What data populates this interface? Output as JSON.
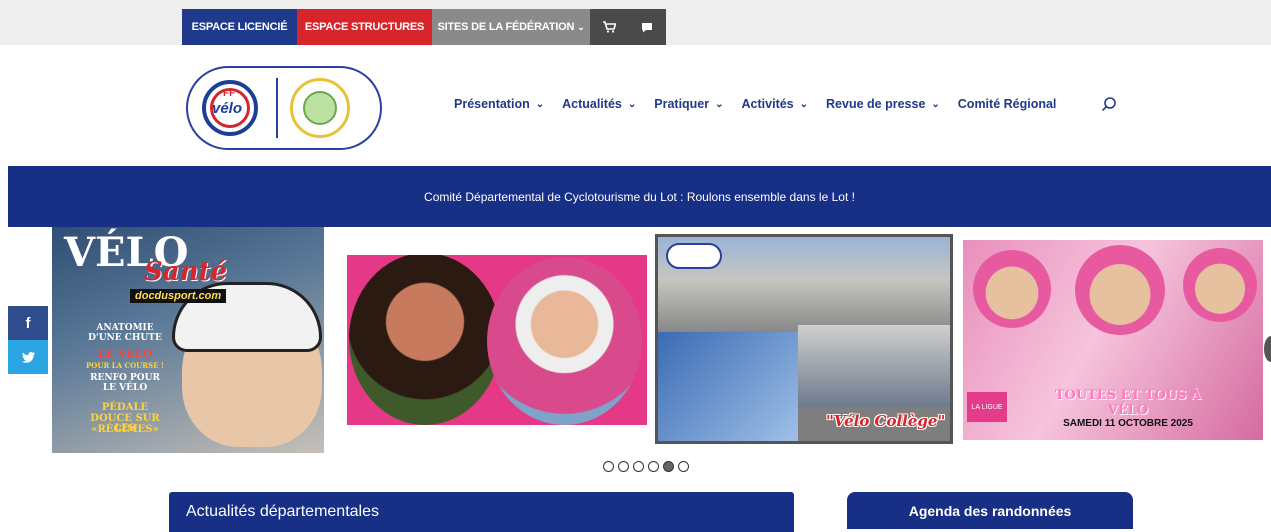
{
  "topbar": {
    "licence": "ESPACE LICENCIÉ",
    "structures": "ESPACE STRUCTURES",
    "sites": "SITES DE LA FÉDÉRATION",
    "cart_icon": "shopping-cart-icon",
    "chat_icon": "chat-bubble-icon"
  },
  "logo": {
    "ff_top": "FF",
    "ff_text": "vélo"
  },
  "nav": {
    "items": [
      {
        "label": "Présentation",
        "dropdown": true
      },
      {
        "label": "Actualités",
        "dropdown": true
      },
      {
        "label": "Pratiquer",
        "dropdown": true
      },
      {
        "label": "Activités",
        "dropdown": true
      },
      {
        "label": "Revue de presse",
        "dropdown": true
      },
      {
        "label": "Comité Régional",
        "dropdown": false
      }
    ],
    "search_icon": "search-icon"
  },
  "banner": {
    "text": "Comité Départemental de Cyclotourisme du Lot : Roulons ensemble dans le Lot !"
  },
  "slides": {
    "s1": {
      "title": "VÉLO",
      "subtitle": "Santé",
      "brand": "docdusport.com",
      "lines": [
        "ANATOMIE",
        "D'UNE CHUTE",
        "LE VÉLO",
        "POUR LA COURSE !",
        "RENFO POUR",
        "LE VÉLO",
        "PÉDALE",
        "DOUCE SUR LES",
        "«RÉGIMES»"
      ]
    },
    "s3": {
      "label": "\"Vélo Collège\""
    },
    "s4": {
      "ligue": "LA LIGUE",
      "headline": "TOUTES ET TOUS À VÉLO",
      "date": "SAMEDI 11 OCTOBRE 2025"
    }
  },
  "social": {
    "facebook": "f",
    "twitter": "🐦"
  },
  "carousel": {
    "dot_count": 6,
    "active_index": 4
  },
  "sections": {
    "news_title": "Actualités départementales",
    "agenda_label": "Agenda des randonnées"
  },
  "colors": {
    "navy": "#182f86",
    "red": "#d6262c",
    "grey": "#8a8a8a"
  }
}
